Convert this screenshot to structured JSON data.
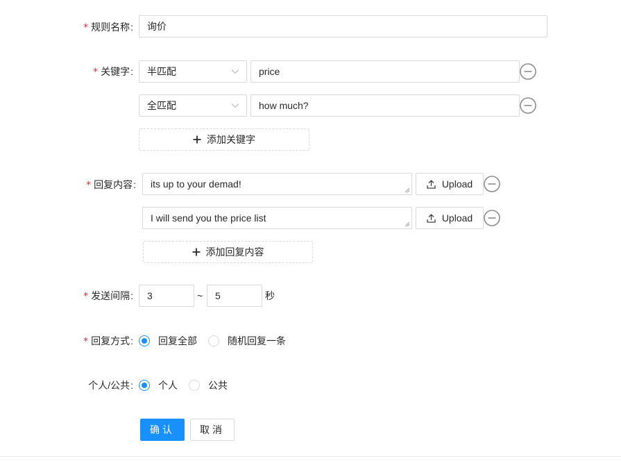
{
  "form": {
    "required_mark": "*",
    "colon": ":",
    "rule_name": {
      "label": "规则名称",
      "value": "询价"
    },
    "keywords": {
      "label": "关键字",
      "rows": [
        {
          "match": "半匹配",
          "value": "price"
        },
        {
          "match": "全匹配",
          "value": "how much?"
        }
      ],
      "add_label": "添加关键字"
    },
    "replies": {
      "label": "回复内容",
      "rows": [
        {
          "value": "its up to your demad!",
          "upload_label": "Upload"
        },
        {
          "value": "I will send you the price list",
          "upload_label": "Upload"
        }
      ],
      "add_label": "添加回复内容"
    },
    "interval": {
      "label": "发送间隔",
      "min": "3",
      "separator": "~",
      "max": "5",
      "unit": "秒"
    },
    "reply_mode": {
      "label": "回复方式",
      "options": [
        {
          "label": "回复全部",
          "checked": true
        },
        {
          "label": "随机回复一条",
          "checked": false
        }
      ]
    },
    "scope": {
      "label": "个人/公共",
      "options": [
        {
          "label": "个人",
          "checked": true
        },
        {
          "label": "公共",
          "checked": false
        }
      ]
    },
    "actions": {
      "confirm": "确认",
      "cancel": "取消"
    }
  },
  "icons": {
    "remove": "minus-circle-icon",
    "add": "plus-icon",
    "upload": "upload-icon",
    "dropdown": "chevron-down-icon",
    "resize": "resize-handle-icon"
  },
  "colors": {
    "primary": "#1890ff",
    "required": "#f5222d",
    "border": "#d9d9d9",
    "icon": "#8c8c8c"
  }
}
